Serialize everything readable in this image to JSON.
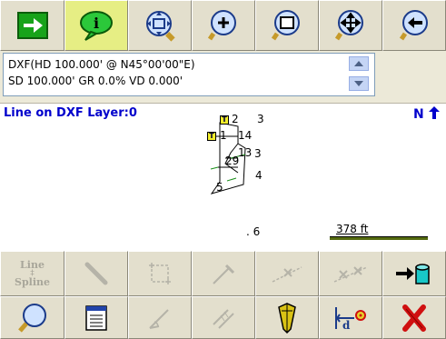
{
  "toolbar_top": {
    "buttons": [
      {
        "name": "go-button",
        "icon": "arrow-right-icon",
        "active": false
      },
      {
        "name": "info-button",
        "icon": "info-bubble-icon",
        "active": true
      },
      {
        "name": "zoom-extents-button",
        "icon": "zoom-extents-icon",
        "active": false
      },
      {
        "name": "zoom-in-button",
        "icon": "zoom-in-icon",
        "active": false
      },
      {
        "name": "zoom-window-button",
        "icon": "zoom-window-icon",
        "active": false
      },
      {
        "name": "pan-button",
        "icon": "pan-icon",
        "active": false
      },
      {
        "name": "previous-view-button",
        "icon": "zoom-previous-icon",
        "active": false
      }
    ]
  },
  "info": {
    "line1": "DXF(HD 100.000' @ N45°00'00\"E)",
    "line2": "SD 100.000'  GR 0.0%  VD 0.000'"
  },
  "map": {
    "layer_label": "Line on DXF Layer:0",
    "north_label": "N",
    "points": [
      "2",
      "3",
      "1",
      "14",
      "13",
      "3",
      "29",
      "4",
      "5",
      ". 6"
    ],
    "scale_text": "378 ft"
  },
  "toolbar_bottom1": {
    "line_spline_label_top": "Line",
    "line_spline_label_bottom": "Spline"
  },
  "colors": {
    "accent_blue": "#0000cc",
    "active_button": "#e6ee84",
    "cancel_red": "#d01010"
  }
}
